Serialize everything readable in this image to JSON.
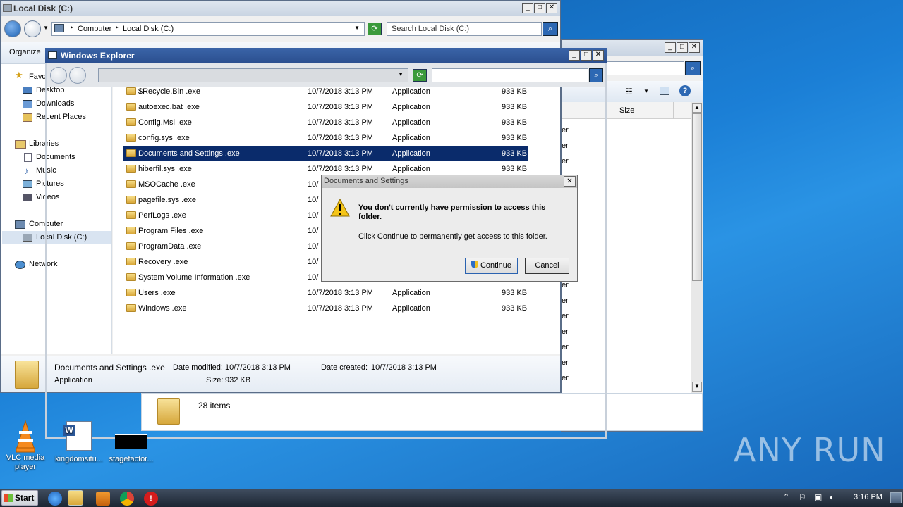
{
  "back_window": {
    "title": "Local Disk (C:)",
    "breadcrumb": [
      "Computer",
      "Local Disk (C:)"
    ],
    "search_placeholder": "Search Local Disk (C:)",
    "organize_label": "Organize",
    "nav": {
      "favorites": "Favorites",
      "desktop": "Desktop",
      "downloads": "Downloads",
      "recent": "Recent Places",
      "libraries": "Libraries",
      "documents": "Documents",
      "music": "Music",
      "pictures": "Pictures",
      "videos": "Videos",
      "computer": "Computer",
      "local_disk": "Local Disk (C:)",
      "network": "Network"
    },
    "details": {
      "name": "Documents and Settings .exe",
      "type": "Application",
      "modified_label": "Date modified:",
      "modified": "10/7/2018 3:13 PM",
      "created_label": "Date created:",
      "created": "10/7/2018 3:13 PM",
      "size_label": "Size:",
      "size": "932 KB"
    }
  },
  "right_window": {
    "col_size": "Size",
    "items_count": "28 items",
    "partial_text": "er"
  },
  "explorer_window": {
    "title": "Windows Explorer"
  },
  "files": [
    {
      "name": "$Recycle.Bin .exe",
      "date": "10/7/2018 3:13 PM",
      "type": "Application",
      "size": "933 KB"
    },
    {
      "name": "autoexec.bat .exe",
      "date": "10/7/2018 3:13 PM",
      "type": "Application",
      "size": "933 KB"
    },
    {
      "name": "Config.Msi .exe",
      "date": "10/7/2018 3:13 PM",
      "type": "Application",
      "size": "933 KB"
    },
    {
      "name": "config.sys .exe",
      "date": "10/7/2018 3:13 PM",
      "type": "Application",
      "size": "933 KB"
    },
    {
      "name": "Documents and Settings .exe",
      "date": "10/7/2018 3:13 PM",
      "type": "Application",
      "size": "933 KB"
    },
    {
      "name": "hiberfil.sys .exe",
      "date": "10/7/2018 3:13 PM",
      "type": "Application",
      "size": "933 KB"
    },
    {
      "name": "MSOCache .exe",
      "date": "10/",
      "type": "",
      "size": ""
    },
    {
      "name": "pagefile.sys .exe",
      "date": "10/",
      "type": "",
      "size": ""
    },
    {
      "name": "PerfLogs .exe",
      "date": "10/",
      "type": "",
      "size": ""
    },
    {
      "name": "Program Files .exe",
      "date": "10/",
      "type": "",
      "size": ""
    },
    {
      "name": "ProgramData .exe",
      "date": "10/",
      "type": "",
      "size": ""
    },
    {
      "name": "Recovery .exe",
      "date": "10/",
      "type": "",
      "size": ""
    },
    {
      "name": "System Volume Information .exe",
      "date": "10/",
      "type": "",
      "size": ""
    },
    {
      "name": "Users .exe",
      "date": "10/7/2018 3:13 PM",
      "type": "Application",
      "size": "933 KB"
    },
    {
      "name": "Windows .exe",
      "date": "10/7/2018 3:13 PM",
      "type": "Application",
      "size": "933 KB"
    }
  ],
  "dialog": {
    "title": "Documents and Settings",
    "heading": "You don't currently have permission to access this folder.",
    "message": "Click Continue to permanently get access to this folder.",
    "continue_label": "Continue",
    "cancel_label": "Cancel"
  },
  "desktop": {
    "icons": [
      {
        "label": "VLC media player"
      },
      {
        "label": "kingdomsitu..."
      },
      {
        "label": "stagefactor..."
      }
    ],
    "watermark": "ANY RUN"
  },
  "taskbar": {
    "start_label": "Start",
    "clock": "3:16 PM"
  },
  "colors": {
    "selection": "#0a2b6b",
    "titlebar_active": "#2b4f8f",
    "desktop": "#1b7fd6"
  }
}
